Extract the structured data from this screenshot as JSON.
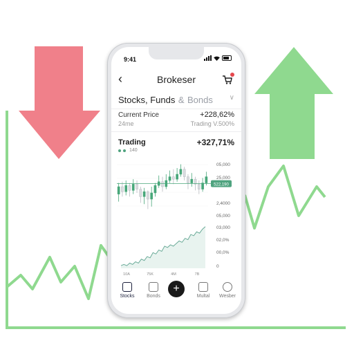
{
  "colors": {
    "accent_green": "#8fd98f",
    "accent_red": "#f0808a",
    "candle_green": "#48a77a",
    "candle_red": "#d9dcdf",
    "badge": "#4fa37f"
  },
  "status_bar": {
    "time": "9:41"
  },
  "header": {
    "title": "Brokeser",
    "back_icon": "chevron-left-icon",
    "basket_icon": "basket-icon"
  },
  "section": {
    "tab_active": "Stocks, Funds",
    "amp": "&",
    "tab_inactive": "Bonds",
    "chevron": "∨"
  },
  "current_price": {
    "label": "Current Price",
    "sub": "24me",
    "value": "+228,62%",
    "trading_label": "Trading V.500%"
  },
  "trading": {
    "label": "Trading",
    "count": "140",
    "value": "+327,71%"
  },
  "chart_data": [
    {
      "type": "candlestick",
      "y_ticks": [
        "05,000",
        "25,000",
        "2,4000",
        "05,000"
      ],
      "price_badge": "522,190",
      "candles": [
        {
          "o": 24,
          "c": 30,
          "h": 33,
          "l": 18
        },
        {
          "o": 30,
          "c": 26,
          "h": 34,
          "l": 22
        },
        {
          "o": 26,
          "c": 31,
          "h": 35,
          "l": 23
        },
        {
          "o": 31,
          "c": 27,
          "h": 33,
          "l": 22
        },
        {
          "o": 27,
          "c": 32,
          "h": 36,
          "l": 24
        },
        {
          "o": 32,
          "c": 28,
          "h": 35,
          "l": 25
        },
        {
          "o": 28,
          "c": 22,
          "h": 30,
          "l": 17
        },
        {
          "o": 22,
          "c": 26,
          "h": 29,
          "l": 16
        },
        {
          "o": 26,
          "c": 20,
          "h": 27,
          "l": 12
        },
        {
          "o": 20,
          "c": 25,
          "h": 30,
          "l": 14
        },
        {
          "o": 25,
          "c": 31,
          "h": 33,
          "l": 22
        },
        {
          "o": 31,
          "c": 34,
          "h": 39,
          "l": 29
        },
        {
          "o": 34,
          "c": 30,
          "h": 38,
          "l": 26
        },
        {
          "o": 30,
          "c": 35,
          "h": 40,
          "l": 28
        },
        {
          "o": 35,
          "c": 38,
          "h": 43,
          "l": 33
        },
        {
          "o": 38,
          "c": 36,
          "h": 44,
          "l": 32
        },
        {
          "o": 36,
          "c": 40,
          "h": 45,
          "l": 34
        },
        {
          "o": 40,
          "c": 44,
          "h": 48,
          "l": 38
        },
        {
          "o": 44,
          "c": 38,
          "h": 46,
          "l": 35
        },
        {
          "o": 38,
          "c": 33,
          "h": 40,
          "l": 28
        },
        {
          "o": 33,
          "c": 36,
          "h": 41,
          "l": 30
        },
        {
          "o": 36,
          "c": 32,
          "h": 38,
          "l": 27
        },
        {
          "o": 32,
          "c": 28,
          "h": 35,
          "l": 24
        },
        {
          "o": 28,
          "c": 33,
          "h": 37,
          "l": 26
        },
        {
          "o": 33,
          "c": 38,
          "h": 42,
          "l": 31
        }
      ],
      "ylim": [
        10,
        50
      ]
    },
    {
      "type": "area",
      "y_ticks": [
        "03,000",
        "02,0%",
        "00,0%",
        "0"
      ],
      "x_labels": [
        "10A",
        "75K",
        "4M",
        "7B"
      ],
      "values": [
        2,
        3,
        2,
        4,
        3,
        5,
        4,
        7,
        6,
        9,
        8,
        12,
        11,
        14,
        13,
        17,
        16,
        18,
        17,
        19,
        21,
        20,
        23,
        22,
        26,
        25,
        28,
        27,
        30,
        32
      ],
      "ylim": [
        0,
        34
      ]
    }
  ],
  "tabbar": {
    "items": [
      {
        "label": "Stocks",
        "icon": "bank-icon"
      },
      {
        "label": "Bonds",
        "icon": "certificate-icon"
      },
      {
        "label": "Multal",
        "icon": "wallet-icon"
      },
      {
        "label": "Wesber",
        "icon": "user-icon"
      }
    ],
    "fab": "+"
  }
}
